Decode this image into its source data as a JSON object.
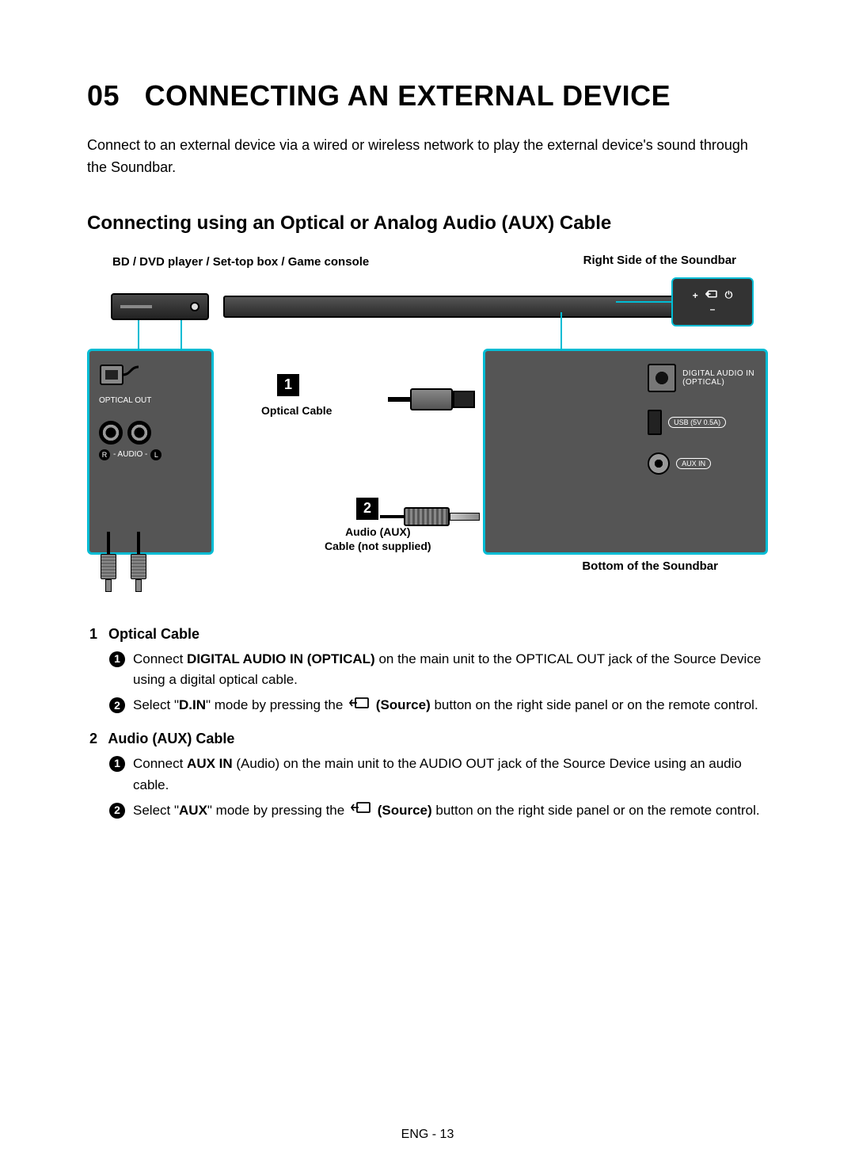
{
  "chapter": {
    "number": "05",
    "title": "CONNECTING AN EXTERNAL DEVICE"
  },
  "intro": "Connect to an external device via a wired or wireless network to play the external device's sound through the Soundbar.",
  "section_title": "Connecting using an Optical or Analog Audio (AUX) Cable",
  "diagram": {
    "source_device_label": "BD / DVD player / Set-top box / Game console",
    "right_side_label": "Right Side of the Soundbar",
    "right_panel": {
      "plus": "+",
      "minus": "–",
      "source_icon": "⇆",
      "power_icon": "⏻"
    },
    "source_panel": {
      "optical_out": "OPTICAL OUT",
      "audio_label": "- AUDIO -",
      "audio_r": "R",
      "audio_l": "L"
    },
    "markers": {
      "one": "1",
      "two": "2"
    },
    "optical_cable_label": "Optical Cable",
    "aux_cable_label_line1": "Audio (AUX)",
    "aux_cable_label_line2": "Cable (not supplied)",
    "bottom_panel": {
      "digital_audio_in_line1": "DIGITAL AUDIO IN",
      "digital_audio_in_line2": "(OPTICAL)",
      "usb_label": "USB (5V 0.5A)",
      "aux_in_label": "AUX IN"
    },
    "bottom_caption": "Bottom of the Soundbar"
  },
  "instructions": [
    {
      "num": "1",
      "heading": "Optical Cable",
      "steps": [
        {
          "bullet": "1",
          "pre": "Connect ",
          "bold1": "DIGITAL AUDIO IN (OPTICAL)",
          "post1": " on the main unit to the OPTICAL OUT jack of the Source Device using a digital optical cable."
        },
        {
          "bullet": "2",
          "pre": "Select \"",
          "bold1": "D.IN",
          "mid1": "\" mode by pressing the ",
          "icon": true,
          "bold2": "(Source)",
          "post1": " button on the right side panel or on the remote control."
        }
      ]
    },
    {
      "num": "2",
      "heading": "Audio (AUX) Cable",
      "steps": [
        {
          "bullet": "1",
          "pre": "Connect ",
          "bold1": "AUX IN",
          "post1": " (Audio) on the main unit to the AUDIO OUT jack of the Source Device using an audio cable."
        },
        {
          "bullet": "2",
          "pre": "Select \"",
          "bold1": "AUX",
          "mid1": "\" mode by pressing the ",
          "icon": true,
          "bold2": "(Source)",
          "post1": " button on the right side panel or on the remote control."
        }
      ]
    }
  ],
  "footer": "ENG - 13"
}
